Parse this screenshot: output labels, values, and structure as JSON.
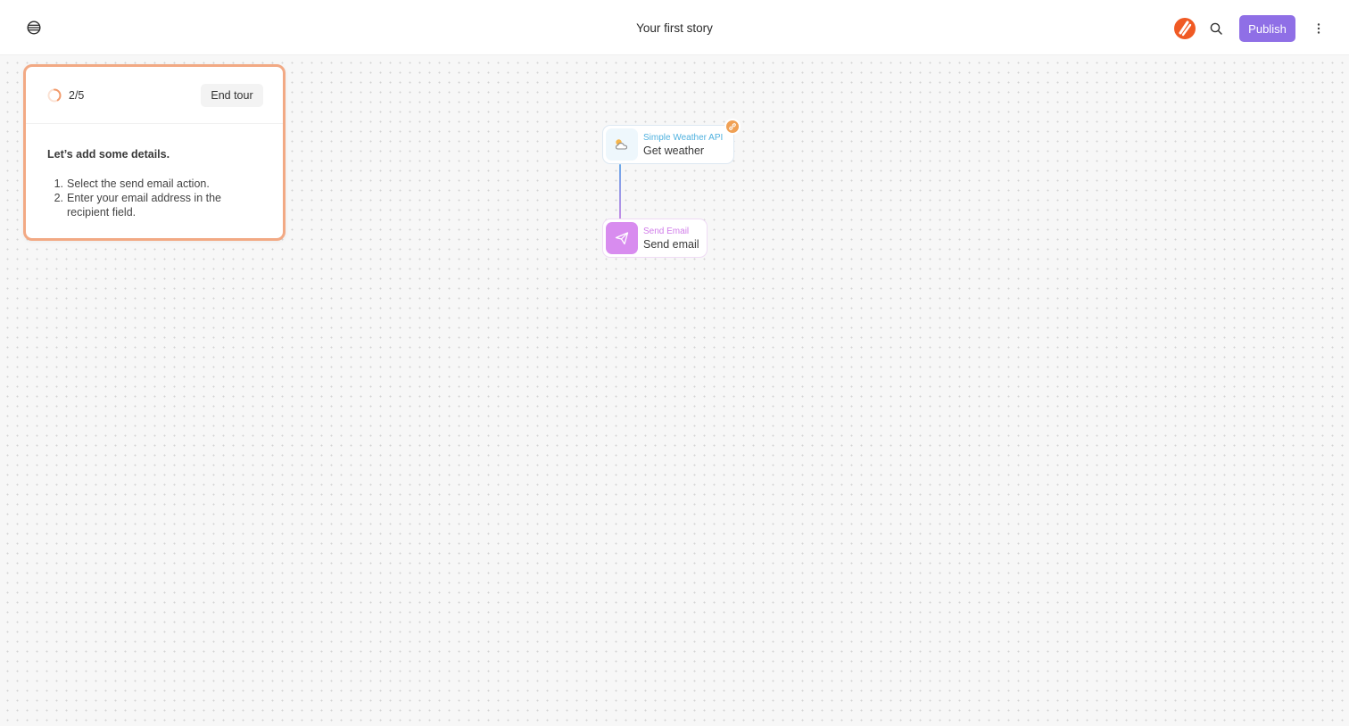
{
  "header": {
    "logo_icon": "tines-logo-icon",
    "story_title": "Your first story",
    "publish_label": "Publish",
    "search_icon": "search-icon",
    "more_icon": "more-vertical-icon"
  },
  "tour": {
    "step": "2/5",
    "progress_fraction": 0.4,
    "end_label": "End tour",
    "heading": "Let’s add some details.",
    "instructions": [
      {
        "num": "1.",
        "text": "Select the send email action."
      },
      {
        "num": "2.",
        "text": "Enter your email address in the recipient field."
      }
    ]
  },
  "nodes": [
    {
      "kind": "Simple Weather API",
      "name": "Get weather",
      "icon": "weather-cloud-icon"
    },
    {
      "kind": "Send Email",
      "name": "Send email",
      "icon": "send-icon"
    }
  ],
  "colors": {
    "accent": "#8f6fe6",
    "tour_border": "#f2a984",
    "weather": "#4fb1df",
    "email": "#d88cef",
    "badge": "#f0a054"
  }
}
